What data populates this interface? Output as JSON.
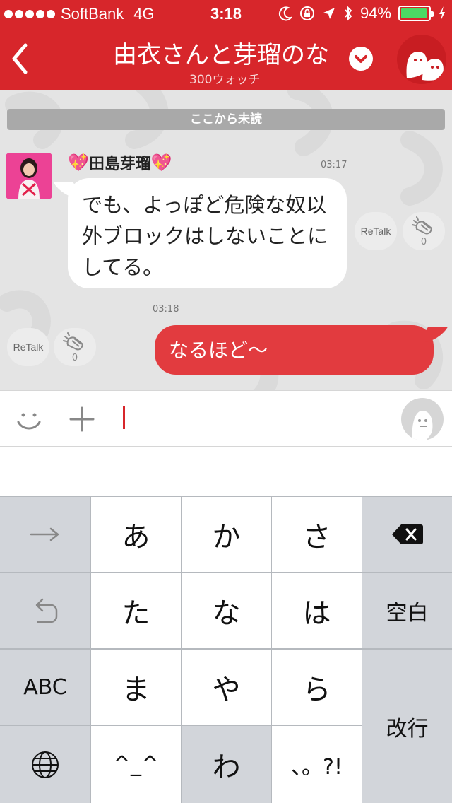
{
  "status_bar": {
    "carrier": "SoftBank",
    "network": "4G",
    "time": "3:18",
    "battery_percent": "94%",
    "battery_level": 0.94,
    "signal_bars": 5
  },
  "header": {
    "title": "由衣さんと芽瑠のな",
    "watch_count": "300ウォッチ"
  },
  "chat": {
    "unread_divider": "ここから未読",
    "messages": [
      {
        "sender": "田島芽瑠",
        "time": "03:17",
        "text": "でも、よっぽど危険な奴以外ブロックはしないことにしてる。",
        "retalk_label": "ReTalk",
        "clap_count": "0"
      },
      {
        "time": "03:18",
        "text": "なるほど〜",
        "retalk_label": "ReTalk",
        "clap_count": "0"
      }
    ]
  },
  "keyboard": {
    "rows": [
      [
        "→",
        "あ",
        "か",
        "さ",
        "⌫"
      ],
      [
        "↺",
        "た",
        "な",
        "は",
        "空白"
      ],
      [
        "ABC",
        "ま",
        "や",
        "ら",
        "改行"
      ],
      [
        "🌐",
        "^^",
        "わ",
        "、。?!"
      ]
    ],
    "keys": {
      "arrow": "→",
      "a": "あ",
      "ka": "か",
      "sa": "さ",
      "ta": "た",
      "na": "な",
      "ha": "は",
      "space": "空白",
      "abc": "ABC",
      "ma": "ま",
      "ya": "や",
      "ra": "ら",
      "enter": "改行",
      "kaomoji": "^_^",
      "wa": "わ",
      "punct": "、。?!"
    }
  },
  "colors": {
    "brand_red": "#d7262b",
    "outgoing_bubble": "#e23b3f",
    "battery_green": "#4cd964"
  }
}
